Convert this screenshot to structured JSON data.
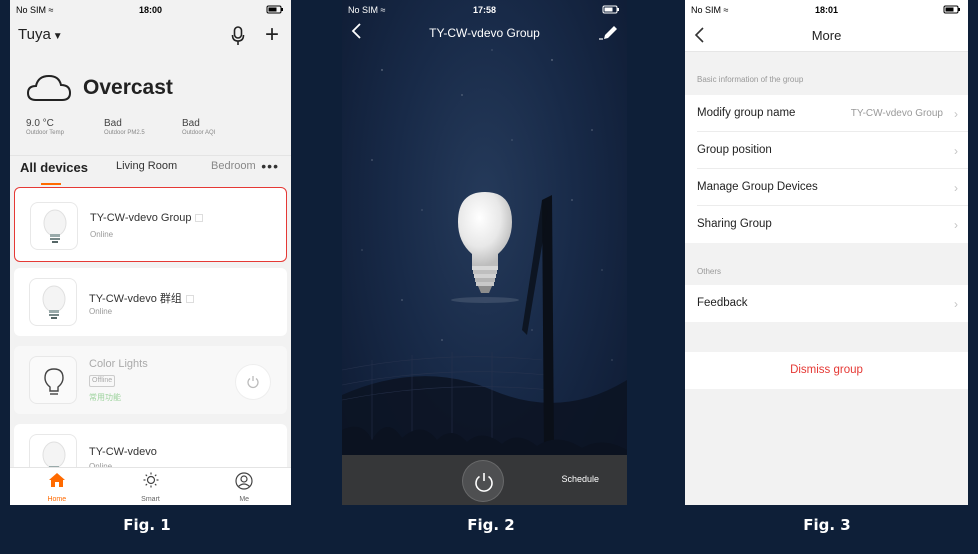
{
  "figures": [
    "Fig. 1",
    "Fig. 2",
    "Fig. 3"
  ],
  "fig1": {
    "status": {
      "carrier": "No SIM",
      "time": "18:00"
    },
    "home_name": "Tuya",
    "weather": {
      "condition": "Overcast",
      "stats": [
        {
          "value": "9.0 °C",
          "label": "Outdoor Temp"
        },
        {
          "value": "Bad",
          "label": "Outdoor PM2.5"
        },
        {
          "value": "Bad",
          "label": "Outdoor AQI"
        }
      ]
    },
    "tabs": [
      "All devices",
      "Living Room",
      "Bedroom"
    ],
    "devices": [
      {
        "name": "TY-CW-vdevo Group",
        "status": "Online"
      },
      {
        "name": "TY-CW-vdevo 群组",
        "status": "Online"
      },
      {
        "name": "Color Lights",
        "status": "Offline",
        "tag": "常用功能"
      },
      {
        "name": "TY-CW-vdevo",
        "status": "Online"
      }
    ],
    "nav": [
      "Home",
      "Smart",
      "Me"
    ],
    "accent": "#ff6a00",
    "highlight": "#e53935"
  },
  "fig2": {
    "status": {
      "carrier": "No SIM",
      "time": "17:58"
    },
    "title": "TY-CW-vdevo Group",
    "schedule_label": "Schedule"
  },
  "fig3": {
    "status": {
      "carrier": "No SIM",
      "time": "18:01"
    },
    "title": "More",
    "section1": "Basic information of the group",
    "rows": [
      {
        "label": "Modify group name",
        "value": "TY-CW-vdevo Group"
      },
      {
        "label": "Group position"
      },
      {
        "label": "Manage Group Devices"
      },
      {
        "label": "Sharing Group"
      }
    ],
    "section2": "Others",
    "feedback": "Feedback",
    "dismiss": "Dismiss group",
    "danger": "#e53935"
  }
}
